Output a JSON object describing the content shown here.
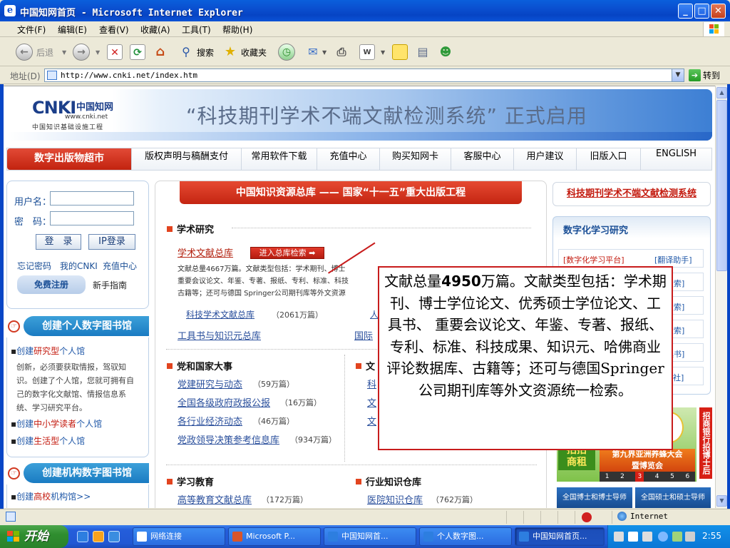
{
  "window": {
    "title": "中国知网首页 - Microsoft Internet Explorer",
    "min_glyph": "_",
    "max_glyph": "□",
    "close_glyph": "✕"
  },
  "menu": [
    "文件(F)",
    "编辑(E)",
    "查看(V)",
    "收藏(A)",
    "工具(T)",
    "帮助(H)"
  ],
  "toolbar": {
    "back": "后退",
    "search": "搜索",
    "favorites": "收藏夹"
  },
  "address": {
    "label": "地址(D)",
    "url": "http://www.cnki.net/index.htm",
    "go": "转到"
  },
  "banner": {
    "logo_text": "CNKI",
    "logo_cn": "中国知网",
    "logo_url": "www.cnki.net",
    "logo_tagline": "中国知识基础设施工程",
    "slogan": "“科技期刊学术不端文献检测系统” 正式启用"
  },
  "nav": {
    "primary": "数字出版物超市",
    "items": [
      "版权声明与稿酬支付",
      "常用软件下载",
      "充值中心",
      "购买知网卡",
      "客服中心",
      "用户建议",
      "旧版入口",
      "ENGLISH"
    ]
  },
  "login": {
    "username_label": "用户名：",
    "password_label": "密　码：",
    "login_button": "登　录",
    "ip_login_button": "IP登录",
    "forgot": "忘记密码",
    "my_cnki": "我的CNKI",
    "recharge": "充值中心",
    "register": "免费注册",
    "newbie": "新手指南"
  },
  "personal_library": {
    "header": "创建个人数字图书馆",
    "items": [
      {
        "prefix": "创建",
        "highlight": "研究型",
        "suffix": "个人馆"
      },
      {
        "prefix": "创建",
        "highlight": "中小学读者",
        "suffix": "个人馆"
      },
      {
        "prefix": "创建",
        "highlight": "生活型",
        "suffix": "个人馆"
      }
    ],
    "description": "创新，必须要获取情报，驾驭知识。创建了个人馆，您就可拥有自己的数字化文献馆、情报信息系统、学习研究平台。"
  },
  "org_library": {
    "header": "创建机构数字图书馆",
    "item_prefix": "创建",
    "item_highlight": "高校",
    "item_suffix": "机构馆>>"
  },
  "center": {
    "ribbon": "中国知识资源总库 —— 国家“十一五”重大出版工程",
    "academic": {
      "title": "学术研究",
      "main_link": "学术文献总库",
      "enter_button": "进入总库检索 ➡",
      "desc_line1": "文献总量4667万篇。文献类型包括：学术期刊、博士",
      "desc_line2": "重要会议论文、年鉴、专著、报纸、专利、标准、科技",
      "desc_line3": "古籍等；还可与德国 Springer公司期刊库等外文资源",
      "sub_link": "科技学术文献总库",
      "sub_count": "（2061万篇）",
      "sub_link2": "人",
      "tools_link": "工具书与知识元总库",
      "intl_link": "国际"
    },
    "party": {
      "title": "党和国家大事",
      "links": [
        {
          "label": "党建研究与动态",
          "count": "（59万篇）"
        },
        {
          "label": "全国各级政府政报公报",
          "count": "（16万篇）"
        },
        {
          "label": "各行业经济动态",
          "count": "（46万篇）"
        },
        {
          "label": "党政领导决策参考信息库",
          "count": "（934万篇）"
        }
      ]
    },
    "culture": {
      "title": "文",
      "links": [
        "科",
        "文",
        "文"
      ]
    },
    "education": {
      "title": "学习教育",
      "link": "高等教育文献总库",
      "count": "（172万篇）"
    },
    "industry": {
      "title": "行业知识仓库",
      "link": "医院知识仓库",
      "count": "（762万篇）"
    }
  },
  "right": {
    "top_link": "科技期刊学术不端文献检测系统",
    "box_title": "数字化学习研究",
    "rows": [
      {
        "left": "[数字化学习平台]",
        "right": "[翻译助手]"
      },
      {
        "left": "",
        "right": "搜索]"
      },
      {
        "left": "",
        "right": "搜索]"
      },
      {
        "left": "",
        "right": "搜索]"
      },
      {
        "left": "",
        "right": "具书]"
      },
      {
        "left": "",
        "right": "出版社]"
      }
    ],
    "ad_zhao": "招招\n商租",
    "ad_expo": "第九界亚洲养蜂大会\n暨博览会",
    "ad_nums": [
      "1",
      "2",
      "3",
      "4",
      "5",
      "6"
    ],
    "ad_tag": "招商银行招博士后",
    "ad_bottom": [
      "全国博士和博士导师",
      "全国硕士和硕士导师"
    ]
  },
  "callout": {
    "pre": "文献总量",
    "number": "4950",
    "post": "万篇。文献类型包括：学术期刊、博士学位论文、优秀硕士学位论文、工具书、 重要会议论文、年鉴、专著、报纸、专利、标准、科技成果、知识元、哈佛商业评论数据库、古籍等；还可与德国Springer公司期刊库等外文资源统一检索。"
  },
  "status": {
    "zone": "Internet"
  },
  "taskbar": {
    "start": "开始",
    "tasks": [
      "网络连接",
      "Microsoft P...",
      "中国知网首...",
      "个人数字图...",
      "中国知网首页..."
    ],
    "clock": "2:55"
  },
  "colors": {
    "accent_red": "#c31a0e",
    "link_blue": "#2a4f9c",
    "xp_blue": "#0a4fd0"
  }
}
